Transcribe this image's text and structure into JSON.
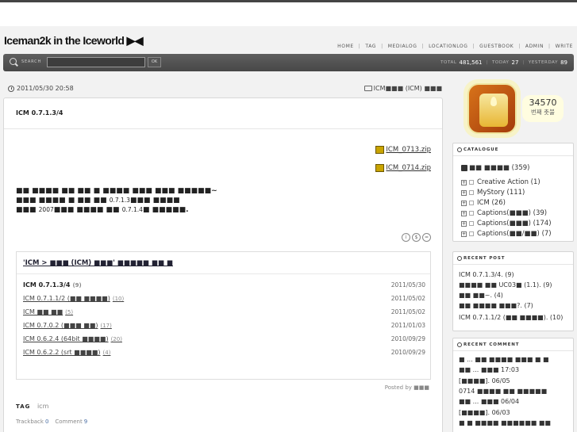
{
  "site": {
    "title": "Iceman2k in the Iceworld ▶◀"
  },
  "nav": [
    "HOME",
    "TAG",
    "MEDIALOG",
    "LOCATIONLOG",
    "GUESTBOOK",
    "ADMIN",
    "WRITE"
  ],
  "search": {
    "label": "SEARCH",
    "value": "",
    "button": "OK"
  },
  "stats": {
    "total_label": "TOTAL",
    "total": "481,561",
    "today_label": "TODAY",
    "today": "27",
    "yesterday_label": "YESTERDAY",
    "yesterday": "89"
  },
  "post": {
    "date": "2011/05/30 20:58",
    "category": "ICM■■■ (ICM) ■■■",
    "title": "ICM 0.7.1.3/4",
    "attachments": [
      "ICM_0713.zip",
      "ICM_0714.zip"
    ],
    "body_line1": "■■ ■■■■ ■■ ■■ ■ ■■■■ ■■■ ■■■ ■■■■■~",
    "body_line2": "■■■ ■■■■ ■ ■■ ■■",
    "body_line2_ver": "0.7.1.3",
    "body_line2_end": "■■■ ■■■■",
    "body_line3_start": "■■■",
    "body_line3_year": "2007",
    "body_line3_mid": "■■■ ■■■■ ■■",
    "body_line3_ver": "0.7.1.4",
    "body_line3_end": "■ ■■■■■.",
    "circle_icons": [
      "i",
      "$",
      "="
    ],
    "related_title": "'ICM > ■■■ (ICM) ■■■' ■■■■■ ■■ ■",
    "related": [
      {
        "title": "ICM 0.7.1.3/4",
        "count": "(9)",
        "date": "2011/05/30"
      },
      {
        "title": "ICM 0.7.1.1/2 (■■ ■■■■)",
        "count": "(10)",
        "date": "2011/05/02"
      },
      {
        "title": "ICM ■■ ■■",
        "count": "(5)",
        "date": "2011/05/02"
      },
      {
        "title": "ICM 0.7.0.2 (■■■ ■■)",
        "count": "(17)",
        "date": "2011/01/03"
      },
      {
        "title": "ICM 0.6.2.4 (64bit ■■■■)",
        "count": "(20)",
        "date": "2010/09/29"
      },
      {
        "title": "ICM 0.6.2.2 (srt ■■■■)",
        "count": "(4)",
        "date": "2010/09/29"
      }
    ],
    "posted_by": "Posted by ■■■",
    "tag_label": "TAG",
    "tag_value": "icm",
    "trackback_label": "Trackback",
    "trackback_count": "0",
    "comment_label": "Comment",
    "comment_count": "9"
  },
  "counter": {
    "number": "34570",
    "label": "번째 촛불"
  },
  "catalogue": {
    "heading": "CATALOGUE",
    "root": "■■ ■■■■ (359)",
    "items": [
      "Creative Action (1)",
      "MyStory (111)",
      "ICM (26)",
      "Captions(■■■) (39)",
      "Captions(■■■) (174)",
      "Captions(■■/■■) (7)"
    ]
  },
  "recent_post": {
    "heading": "RECENT POST",
    "items": [
      "ICM 0.7.1.3/4. (9)",
      "■■■■ ■■ UC03■ (1.1). (9)",
      "■■ ■■~. (4)",
      "■■ ■■■■ ■■■?. (7)",
      "ICM 0.7.1.1/2 (■■ ■■■■). (10)"
    ]
  },
  "recent_comment": {
    "heading": "RECENT COMMENT",
    "items": [
      "■ ... ■■ ■■■■ ■■■ ■ ■",
      "■■ ... ■■■ 17:03",
      "[■■■■]. 06/05",
      "0714 ■■■■ ■■ ■■■■■",
      "■■ ... ■■■ 06/04",
      "[■■■■]. 06/03",
      "■ ■ ■■■■ ■■■■■■ ■■"
    ]
  }
}
